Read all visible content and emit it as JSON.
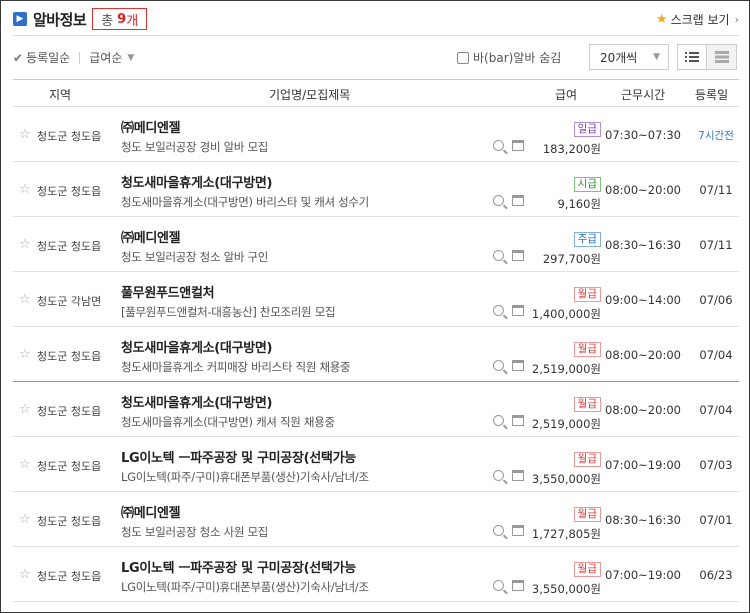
{
  "header": {
    "logo_glyph": "▶",
    "title": "알바정보",
    "count_prefix": "총",
    "count_value": "9",
    "count_unit": "개",
    "scrap_label": "스크랩 보기",
    "scrap_chevron": "›"
  },
  "toolbar": {
    "sort_date": "등록일순",
    "sort_pay": "급여순",
    "hide_bar_label": "바(bar)알바 숨김",
    "per_page": "20개씩"
  },
  "columns": {
    "region": "지역",
    "company_title": "기업명/모집제목",
    "pay": "급여",
    "hours": "근무시간",
    "registered": "등록일"
  },
  "rows": [
    {
      "region": "청도군 청도읍",
      "company": "㈜메디엔젤",
      "title": "청도 보일러공장 경비 알바 모집",
      "pay_type": "일급",
      "pay_class": "daily",
      "amount": "183,200원",
      "hours": "07:30~07:30",
      "registered": "7시간전"
    },
    {
      "region": "청도군 청도읍",
      "company": "청도새마을휴게소(대구방면)",
      "title": "청도새마을휴게소(대구방면) 바리스타 및 캐셔 성수기",
      "pay_type": "시급",
      "pay_class": "hourly",
      "amount": "9,160원",
      "hours": "08:00~20:00",
      "registered": "07/11"
    },
    {
      "region": "청도군 청도읍",
      "company": "㈜메디엔젤",
      "title": "청도 보일러공장 청소 알바 구인",
      "pay_type": "주급",
      "pay_class": "weekly",
      "amount": "297,700원",
      "hours": "08:30~16:30",
      "registered": "07/11"
    },
    {
      "region": "청도군 각남면",
      "company": "풀무원푸드앤컬처",
      "title": "[풀무원푸드앤컬처-대흥농산] 찬모조리원 모집",
      "pay_type": "월급",
      "pay_class": "monthly",
      "amount": "1,400,000원",
      "hours": "09:00~14:00",
      "registered": "07/06"
    },
    {
      "region": "청도군 청도읍",
      "company": "청도새마을휴게소(대구방면)",
      "title": "청도새마을휴게소 커피매장 바리스타 직원 채용중",
      "pay_type": "월급",
      "pay_class": "monthly",
      "amount": "2,519,000원",
      "hours": "08:00~20:00",
      "registered": "07/04"
    },
    {
      "region": "청도군 청도읍",
      "company": "청도새마을휴게소(대구방면)",
      "title": "청도새마을휴게소(대구방면) 캐셔 직원 채용중",
      "pay_type": "월급",
      "pay_class": "monthly",
      "amount": "2,519,000원",
      "hours": "08:00~20:00",
      "registered": "07/04"
    },
    {
      "region": "청도군 청도읍",
      "company": "LG이노텍 ㅡ파주공장 및 구미공장(선택가능",
      "title": "LG이노텍(파주/구미)휴대폰부품(생산)기숙사/남녀/조",
      "pay_type": "월급",
      "pay_class": "monthly",
      "amount": "3,550,000원",
      "hours": "07:00~19:00",
      "registered": "07/03"
    },
    {
      "region": "청도군 청도읍",
      "company": "㈜메디엔젤",
      "title": "청도 보일러공장 청소 사원 모집",
      "pay_type": "월급",
      "pay_class": "monthly",
      "amount": "1,727,805원",
      "hours": "08:30~16:30",
      "registered": "07/01"
    },
    {
      "region": "청도군 청도읍",
      "company": "LG이노텍 ㅡ파주공장 및 구미공장(선택가능",
      "title": "LG이노텍(파주/구미)휴대폰부품(생산)기숙사/남녀/조",
      "pay_type": "월급",
      "pay_class": "monthly",
      "amount": "3,550,000원",
      "hours": "07:00~19:00",
      "registered": "06/23"
    }
  ]
}
